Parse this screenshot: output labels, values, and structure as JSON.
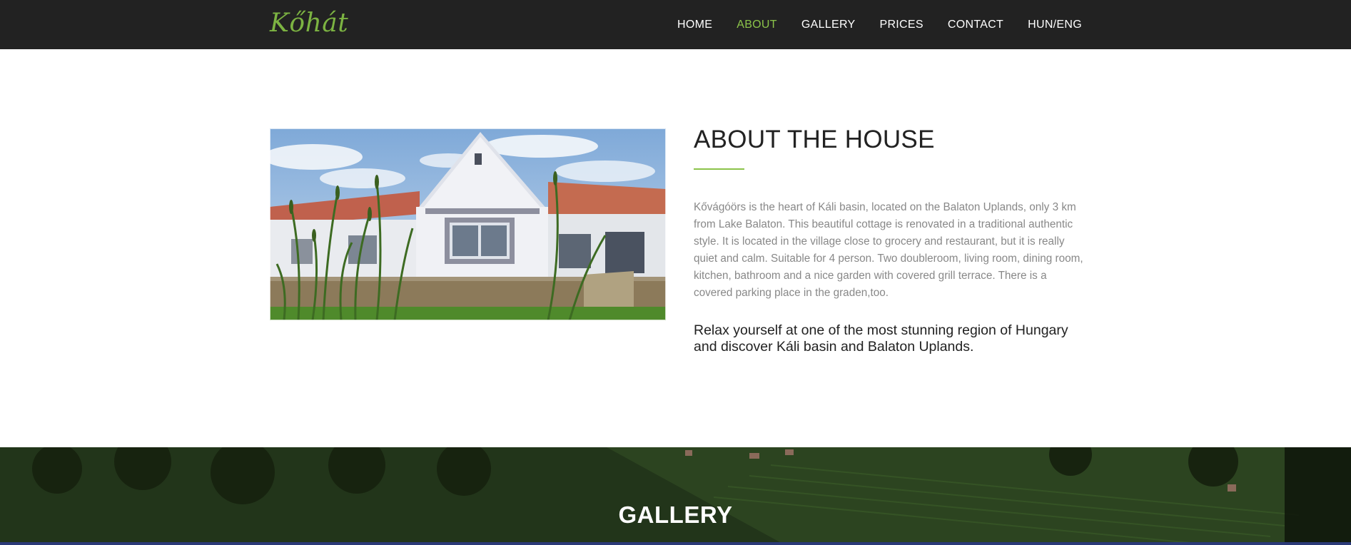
{
  "brand": {
    "name": "Kőhát"
  },
  "nav": {
    "items": [
      {
        "label": "HOME",
        "active": false
      },
      {
        "label": "ABOUT",
        "active": true
      },
      {
        "label": "GALLERY",
        "active": false
      },
      {
        "label": "PRICES",
        "active": false
      },
      {
        "label": "CONTACT",
        "active": false
      },
      {
        "label": "HUN/ENG",
        "active": false
      }
    ]
  },
  "about": {
    "title": "ABOUT THE HOUSE",
    "text": "Kővágóörs is the heart of Káli basin, located on the Balaton Uplands, only 3 km from Lake Balaton. This beautiful cottage is renovated in a traditional authentic style. It is located in the village close to grocery and restaurant, but it is really quiet and calm. Suitable for 4 person. Two doubleroom, living room, dining room, kitchen, bathroom and a nice garden with covered grill terrace. There is a covered parking place in the graden,too.",
    "lead": "Relax yourself at one of the most stunning region of Hungary and discover Káli basin and Balaton Uplands."
  },
  "gallery": {
    "title": "GALLERY"
  },
  "colors": {
    "navbar_bg": "#222222",
    "accent": "#8bc34a",
    "text_dark": "#222222",
    "text_muted": "#888888"
  }
}
